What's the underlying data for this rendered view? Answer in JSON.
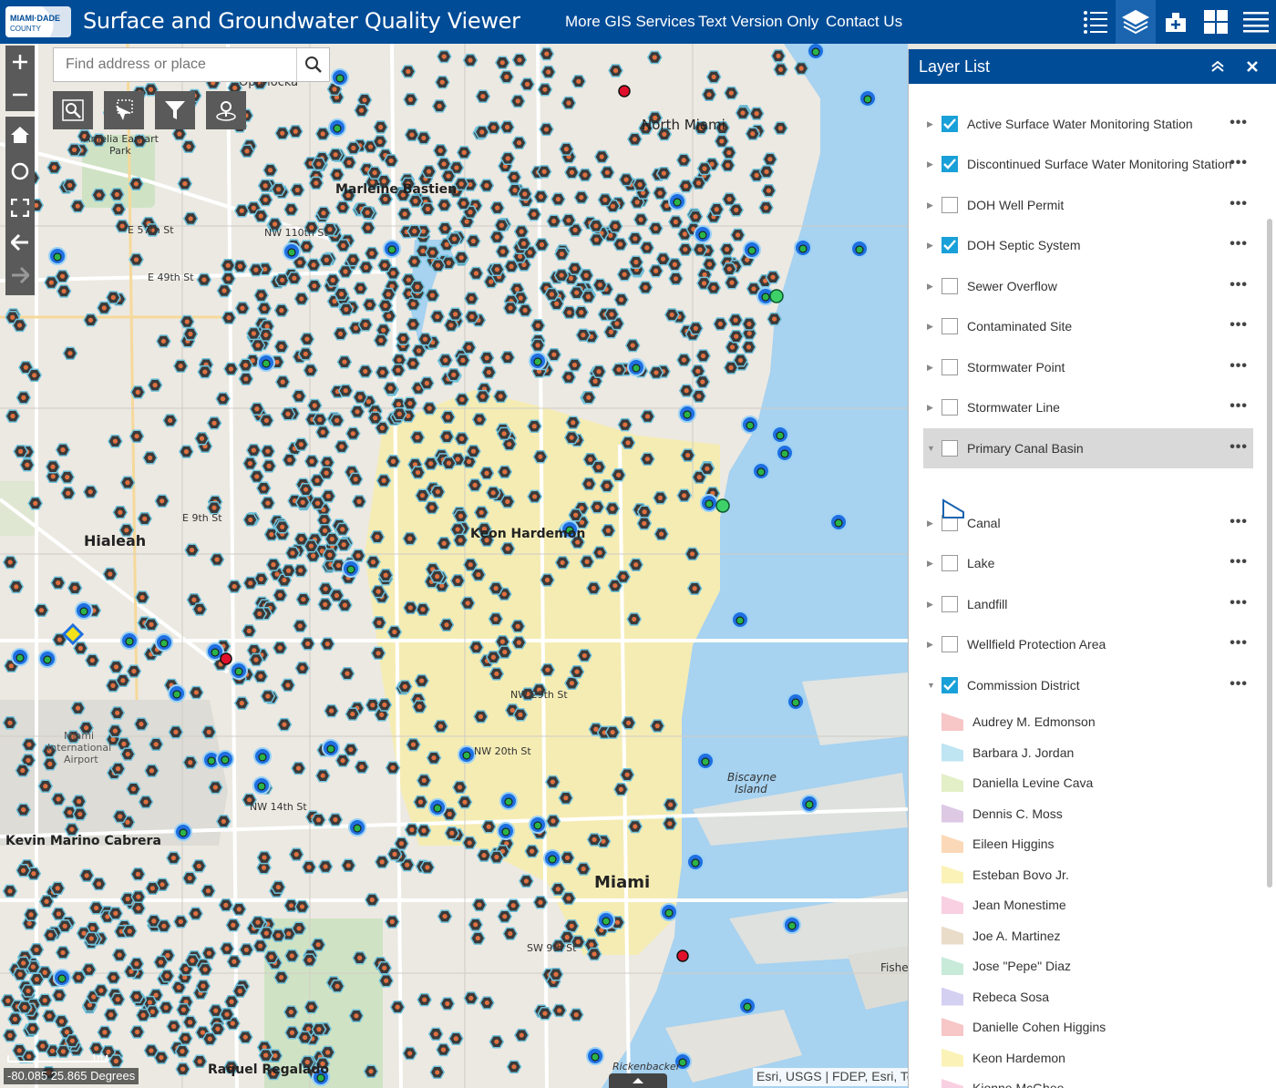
{
  "header": {
    "logo_top": "MIAMI·DADE",
    "logo_bottom": "COUNTY",
    "title": "Surface and Groundwater Quality Viewer",
    "links": [
      "More GIS Services",
      "Text Version Only",
      "Contact Us"
    ],
    "tools": [
      "legend-list-icon",
      "layers-icon",
      "add-data-icon",
      "basemap-gallery-icon",
      "menu-icon"
    ],
    "active_tool": "layers-icon"
  },
  "search": {
    "placeholder": "Find address or place"
  },
  "map": {
    "labels": [
      {
        "text": "Opa-locka",
        "cls": ""
      },
      {
        "text": "North Miami",
        "cls": "med"
      },
      {
        "text": "Amelia Earhart",
        "cls": ""
      },
      {
        "text": "Park",
        "cls": ""
      },
      {
        "text": "Marleine Bastien",
        "cls": "big"
      },
      {
        "text": "E 57th St",
        "cls": ""
      },
      {
        "text": "NW 110th St",
        "cls": ""
      },
      {
        "text": "E 49th St",
        "cls": ""
      },
      {
        "text": "Hialeah",
        "cls": "big"
      },
      {
        "text": "E 9th St",
        "cls": ""
      },
      {
        "text": "Keon Hardemon",
        "cls": "big"
      },
      {
        "text": "Miami",
        "cls": ""
      },
      {
        "text": "International",
        "cls": ""
      },
      {
        "text": "Airport",
        "cls": ""
      },
      {
        "text": "NW 14th St",
        "cls": ""
      },
      {
        "text": "NW 29th St",
        "cls": ""
      },
      {
        "text": "NW 20th St",
        "cls": ""
      },
      {
        "text": "Kevin Marino Cabrera",
        "cls": "big"
      },
      {
        "text": "Biscayne",
        "cls": ""
      },
      {
        "text": "Island",
        "cls": ""
      },
      {
        "text": "Miami",
        "cls": "big"
      },
      {
        "text": "SW 9th St",
        "cls": ""
      },
      {
        "text": "Raquel Regalado",
        "cls": "big"
      },
      {
        "text": "Fisher",
        "cls": ""
      },
      {
        "text": "Rickenbacker",
        "cls": ""
      }
    ],
    "coords": "-80.085 25.865 Degrees",
    "attribution": "Esri, USGS | FDEP, Esri, TomTom",
    "scale": "1mi"
  },
  "layer_panel": {
    "title": "Layer List",
    "layers": [
      {
        "name": "Active Surface Water Monitoring Station",
        "checked": true
      },
      {
        "name": "Discontinued Surface Water Monitoring Station",
        "checked": true
      },
      {
        "name": "DOH Well Permit",
        "checked": false
      },
      {
        "name": "DOH Septic System",
        "checked": true
      },
      {
        "name": "Sewer Overflow",
        "checked": false
      },
      {
        "name": "Contaminated Site",
        "checked": false
      },
      {
        "name": "Stormwater Point",
        "checked": false
      },
      {
        "name": "Stormwater Line",
        "checked": false
      },
      {
        "name": "Primary Canal Basin",
        "checked": false
      },
      {
        "name": "Canal",
        "checked": false
      },
      {
        "name": "Lake",
        "checked": false
      },
      {
        "name": "Landfill",
        "checked": false
      },
      {
        "name": "Wellfield Protection Area",
        "checked": false
      },
      {
        "name": "Commission District",
        "checked": true
      }
    ],
    "districts": [
      {
        "name": "Audrey M. Edmonson",
        "color": "#f7c6c7"
      },
      {
        "name": "Barbara J. Jordan",
        "color": "#bfe4f2"
      },
      {
        "name": "Daniella Levine Cava",
        "color": "#e3efc6"
      },
      {
        "name": "Dennis C. Moss",
        "color": "#ddc9e4"
      },
      {
        "name": "Eileen Higgins",
        "color": "#fbd9b8"
      },
      {
        "name": "Esteban Bovo Jr.",
        "color": "#fbf2b8"
      },
      {
        "name": "Jean Monestime",
        "color": "#f9d0e2"
      },
      {
        "name": "Joe A. Martinez",
        "color": "#e9dcc8"
      },
      {
        "name": "Jose \"Pepe\" Diaz",
        "color": "#c7ead9"
      },
      {
        "name": "Rebeca Sosa",
        "color": "#d4d0f2"
      },
      {
        "name": "Danielle Cohen Higgins",
        "color": "#f7c6c7"
      },
      {
        "name": "Keon Hardemon",
        "color": "#fbf2b8"
      },
      {
        "name": "Kionne McGhee",
        "color": "#f9d0e2"
      }
    ]
  }
}
